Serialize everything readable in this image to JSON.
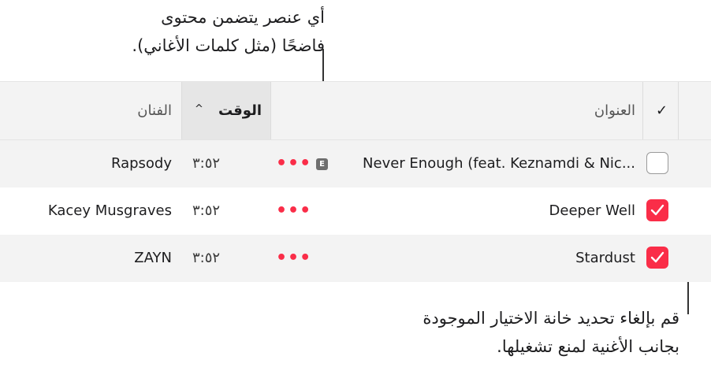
{
  "callouts": {
    "top_line1": "أي عنصر يتضمن محتوى",
    "top_line2": "فاضحًا (مثل كلمات الأغاني).",
    "bottom_line1": "قم بإلغاء تحديد خانة الاختيار الموجودة",
    "bottom_line2": "بجانب الأغنية لمنع تشغيلها."
  },
  "table": {
    "headers": {
      "check": "✓",
      "title": "العنوان",
      "time": "الوقت",
      "sort_indicator": "^",
      "artist": "الفنان"
    },
    "rows": [
      {
        "checked": false,
        "title": "Never Enough (feat. Keznamdi & Nic...",
        "explicit": "E",
        "more": "•••",
        "time": "٣:٥٢",
        "artist": "Rapsody"
      },
      {
        "checked": true,
        "title": "Deeper Well",
        "more": "•••",
        "time": "٣:٥٢",
        "artist": "Kacey Musgraves"
      },
      {
        "checked": true,
        "title": "Stardust",
        "more": "•••",
        "time": "٣:٥٢",
        "artist": "ZAYN"
      }
    ]
  },
  "colors": {
    "accent": "#fa2d48",
    "row_alt": "#f3f3f3"
  }
}
